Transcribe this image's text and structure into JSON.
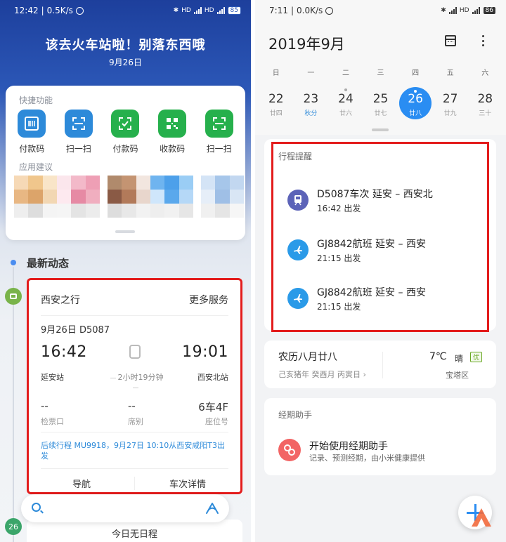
{
  "left": {
    "status": {
      "time": "12:42",
      "speed": "0.5K/s",
      "battery": "85"
    },
    "hero": {
      "title": "该去火车站啦！别落东西哦",
      "date": "9月26日"
    },
    "quick": {
      "label": "快捷功能",
      "items": [
        {
          "label": "付款码",
          "icon": "barcode-icon",
          "color": "#2d8ad9"
        },
        {
          "label": "扫一扫",
          "icon": "scan-icon",
          "color": "#2d8ad9"
        },
        {
          "label": "付款码",
          "icon": "wechat-pay-icon",
          "color": "#26b04c"
        },
        {
          "label": "收款码",
          "icon": "qrcode-icon",
          "color": "#26b04c"
        },
        {
          "label": "扫一扫",
          "icon": "wechat-scan-icon",
          "color": "#26b04c"
        }
      ],
      "suggest_label": "应用建议"
    },
    "timeline": {
      "title": "最新动态",
      "day_badge": "26"
    },
    "trip": {
      "title": "西安之行",
      "more": "更多服务",
      "date_train": "9月26日  D5087",
      "depart_time": "16:42",
      "arrive_time": "19:01",
      "depart_station": "延安站",
      "arrive_station": "西安北站",
      "duration": "2小时19分钟",
      "gate_value": "--",
      "gate_label": "检票口",
      "seat_class_value": "--",
      "seat_class_label": "席别",
      "seat_value": "6车4F",
      "seat_label": "座位号",
      "follow": "后续行程 MU9918，9月27日 10:10从西安咸阳T3出发",
      "nav": "导航",
      "detail": "车次详情"
    },
    "no_event": "今日无日程"
  },
  "right": {
    "status": {
      "time": "7:11",
      "speed": "0.0K/s",
      "battery": "86"
    },
    "month": "2019年9月",
    "weekdays": [
      "日",
      "一",
      "二",
      "三",
      "四",
      "五",
      "六"
    ],
    "days": [
      {
        "n": "22",
        "l": "廿四"
      },
      {
        "n": "23",
        "l": "秋分"
      },
      {
        "n": "24",
        "l": "廿六"
      },
      {
        "n": "25",
        "l": "廿七"
      },
      {
        "n": "26",
        "l": "廿八"
      },
      {
        "n": "27",
        "l": "廿九"
      },
      {
        "n": "28",
        "l": "三十"
      }
    ],
    "schedule": {
      "title": "行程提醒",
      "events": [
        {
          "title": "D5087车次  延安 – 西安北",
          "sub": "16:42 出发",
          "icon": "train-icon",
          "color": "#5c63b8"
        },
        {
          "title": "GJ8842航班  延安 – 西安",
          "sub": "21:15 出发",
          "icon": "plane-icon",
          "color": "#2a9ae8"
        },
        {
          "title": "GJ8842航班  延安 – 西安",
          "sub": "21:15 出发",
          "icon": "plane-icon",
          "color": "#2a9ae8"
        }
      ]
    },
    "lunar": {
      "date": "农历八月廿八",
      "ganzhi": "己亥猪年 癸酉月 丙寅日",
      "temp": "7℃",
      "weather": "晴",
      "aqi": "优",
      "location": "宝塔区"
    },
    "period": {
      "title": "经期助手",
      "action": "开始使用经期助手",
      "desc": "记录、预测经期，由小米健康提供"
    }
  }
}
